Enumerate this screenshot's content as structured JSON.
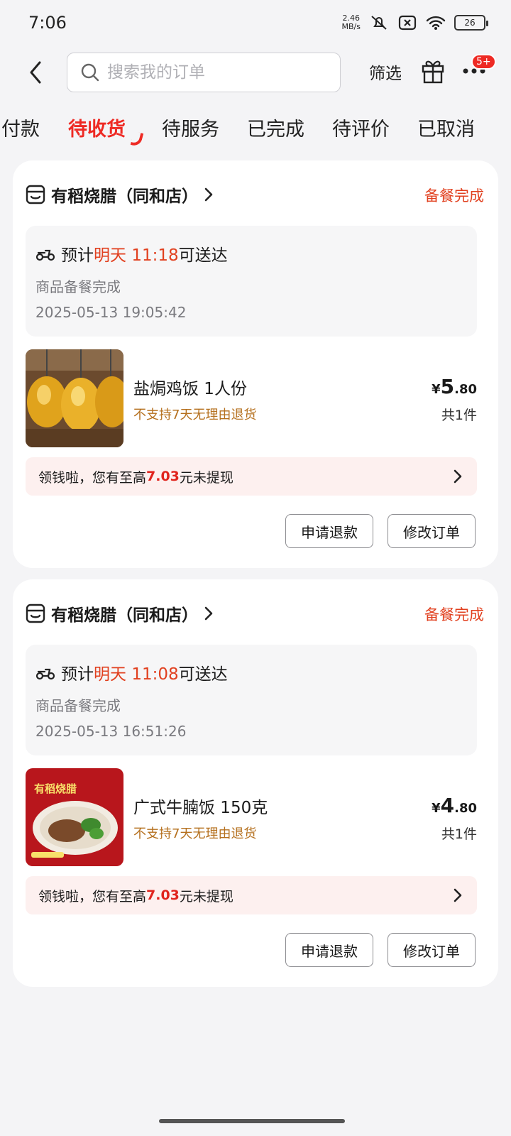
{
  "status_bar": {
    "time": "7:06",
    "net_speed_top": "2.46",
    "net_speed_bottom": "MB/s",
    "battery": "26"
  },
  "header": {
    "search_placeholder": "搜索我的订单",
    "filter_label": "筛选",
    "badge": "5+"
  },
  "tabs": [
    {
      "label": "待付款",
      "shown": "付款"
    },
    {
      "label": "待收货",
      "active": true
    },
    {
      "label": "待服务"
    },
    {
      "label": "已完成"
    },
    {
      "label": "待评价"
    },
    {
      "label": "已取消"
    }
  ],
  "orders": [
    {
      "store": "有稻烧腊（同和店）",
      "status": "备餐完成",
      "delivery_prefix": "预计",
      "delivery_day": "明天",
      "delivery_time": "11:18",
      "delivery_suffix": "可送达",
      "sub_status": "商品备餐完成",
      "timestamp": "2025-05-13 19:05:42",
      "product_name": "盐焗鸡饭 1人份",
      "product_note": "不支持7天无理由退货",
      "price_symbol": "¥",
      "price_int": "5",
      "price_dec": ".80",
      "qty": "共1件",
      "promo_prefix": "领钱啦，您有至高",
      "promo_amount": "7.03",
      "promo_suffix": "元未提现",
      "btn_refund": "申请退款",
      "btn_modify": "修改订单",
      "image": "roast-chicken-image"
    },
    {
      "store": "有稻烧腊（同和店）",
      "status": "备餐完成",
      "delivery_prefix": "预计",
      "delivery_day": "明天",
      "delivery_time": "11:08",
      "delivery_suffix": "可送达",
      "sub_status": "商品备餐完成",
      "timestamp": "2025-05-13 16:51:26",
      "product_name": "广式牛腩饭 150克",
      "product_note": "不支持7天无理由退货",
      "price_symbol": "¥",
      "price_int": "4",
      "price_dec": ".80",
      "qty": "共1件",
      "promo_prefix": "领钱啦，您有至高",
      "promo_amount": "7.03",
      "promo_suffix": "元未提现",
      "btn_refund": "申请退款",
      "btn_modify": "修改订单",
      "image": "beef-brisket-rice-image",
      "image_text": "有稻烧腊"
    }
  ],
  "colors": {
    "accent": "#ee2a24",
    "status": "#e1401f",
    "note": "#b5701e",
    "promo_bg": "#fdf0ef"
  }
}
